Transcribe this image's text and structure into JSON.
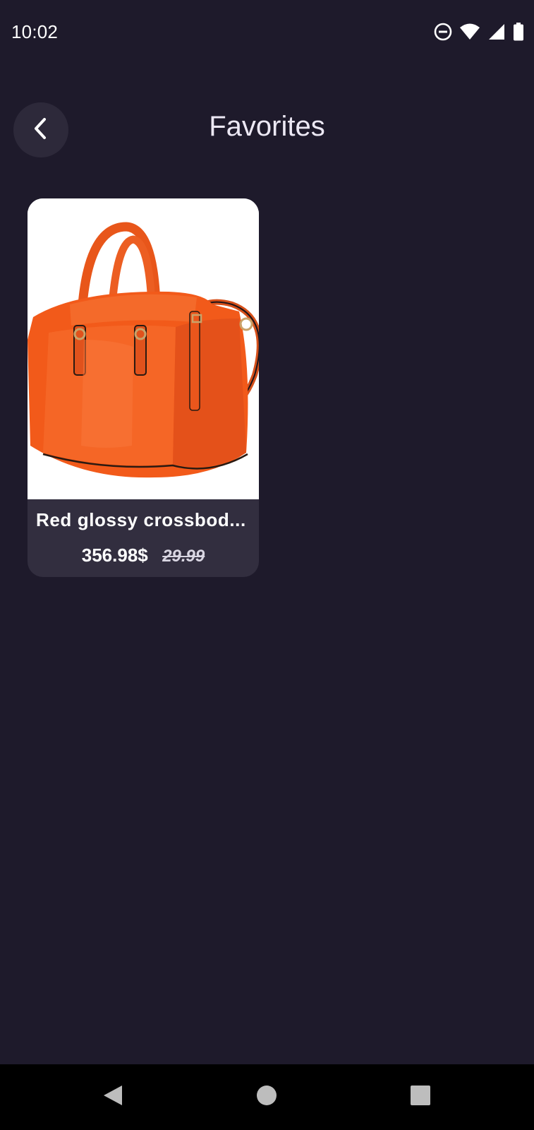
{
  "status_bar": {
    "time": "10:02",
    "icons": [
      "do-not-disturb-icon",
      "wifi-icon",
      "signal-icon",
      "battery-icon"
    ]
  },
  "header": {
    "back_icon": "chevron-left-icon",
    "title": "Favorites"
  },
  "favorites": [
    {
      "name": "Red glossy crossbod...",
      "price": "356.98$",
      "old_price": "29.99",
      "image": "orange-handbag"
    }
  ],
  "nav_bar": {
    "back_icon": "triangle-back-icon",
    "home_icon": "circle-home-icon",
    "recents_icon": "square-recents-icon"
  },
  "colors": {
    "background": "#1e1a2b",
    "card": "#322e3f",
    "back_button": "#2d293a",
    "product": "#f25a1a"
  }
}
